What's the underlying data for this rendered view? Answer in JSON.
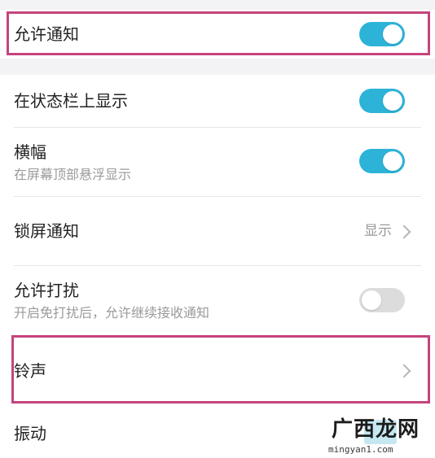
{
  "colors": {
    "toggle_on": "#2db3d8",
    "toggle_off": "#dcdcdc",
    "highlight": "#c4447c",
    "separator_band": "#f3f3f5"
  },
  "settings": [
    {
      "id": "allow_notifications",
      "title": "允许通知",
      "toggle": "on"
    },
    {
      "id": "status_bar",
      "title": "在状态栏上显示",
      "toggle": "on"
    },
    {
      "id": "banner",
      "title": "横幅",
      "subtitle": "在屏幕顶部悬浮显示",
      "toggle": "on"
    },
    {
      "id": "lock_screen",
      "title": "锁屏通知",
      "value": "显示"
    },
    {
      "id": "allow_disturb",
      "title": "允许打扰",
      "subtitle": "开启免打扰后，允许继续接收通知",
      "toggle": "off"
    },
    {
      "id": "ringtone",
      "title": "铃声"
    },
    {
      "id": "vibration",
      "title": "振动"
    }
  ],
  "watermark": {
    "brand": "广西龙网",
    "domain": "mingyan1.com"
  }
}
